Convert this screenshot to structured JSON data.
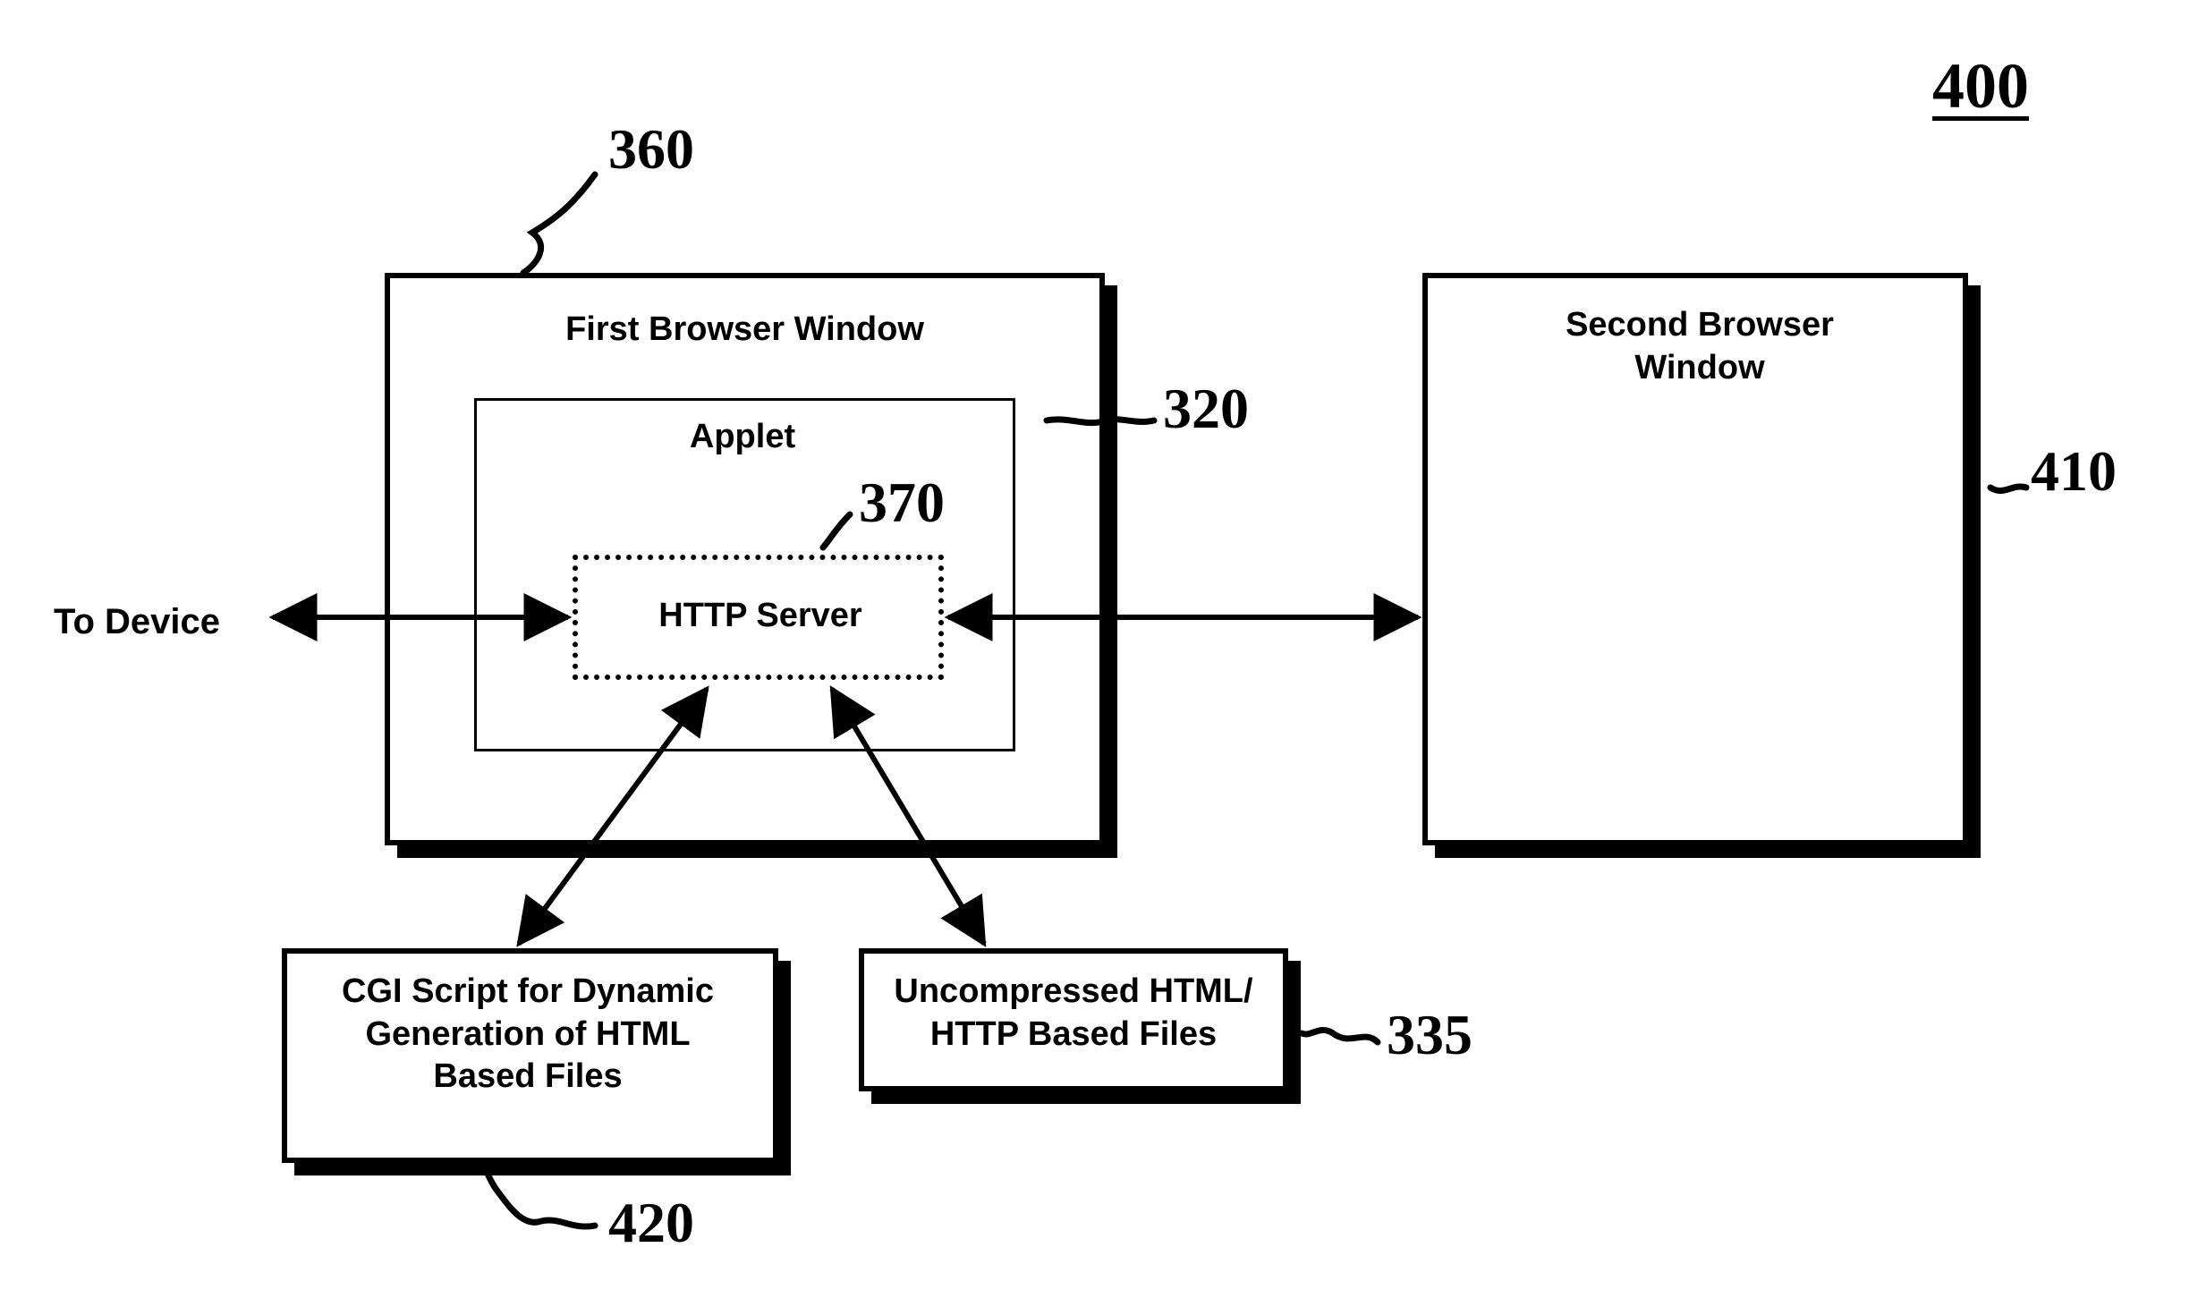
{
  "figure_number": "400",
  "boxes": {
    "first_window": {
      "title": "First Browser Window",
      "ref": "360"
    },
    "applet": {
      "title": "Applet",
      "ref": "320"
    },
    "http_server": {
      "title": "HTTP Server",
      "ref": "370"
    },
    "second_window": {
      "title": "Second Browser\nWindow",
      "ref": "410"
    },
    "cgi": {
      "title": "CGI Script for Dynamic\nGeneration of HTML\nBased Files",
      "ref": "420"
    },
    "files": {
      "title": "Uncompressed HTML/\nHTTP Based Files",
      "ref": "335"
    }
  },
  "external": {
    "to_device": "To Device"
  }
}
